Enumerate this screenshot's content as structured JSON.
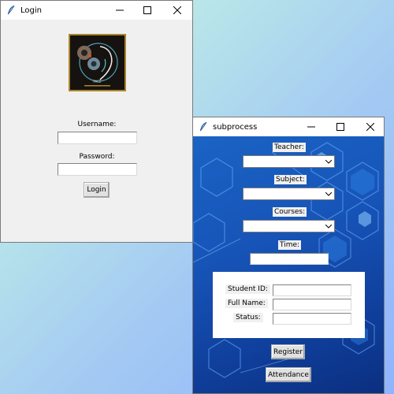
{
  "login_window": {
    "title": "Login",
    "username_label": "Username:",
    "username_value": "",
    "password_label": "Password:",
    "password_value": "",
    "login_button": "Login",
    "logo_icon": "face-with-gears-logo"
  },
  "sub_window": {
    "title": "subprocess",
    "teacher_label": "Teacher:",
    "teacher_value": "",
    "subject_label": "Subject:",
    "subject_value": "",
    "courses_label": "Courses:",
    "courses_value": "",
    "time_label": "Time:",
    "time_value": "",
    "student_id_label": "Student ID:",
    "full_name_label": "Full Name:",
    "status_label": "Status:",
    "register_button": "Register",
    "attendance_button": "Attendance"
  },
  "colors": {
    "desktop_from": "#c8f5e0",
    "desktop_to": "#8fb4ff",
    "sub_background": "#1754b8",
    "logo_border": "#a9862c"
  }
}
